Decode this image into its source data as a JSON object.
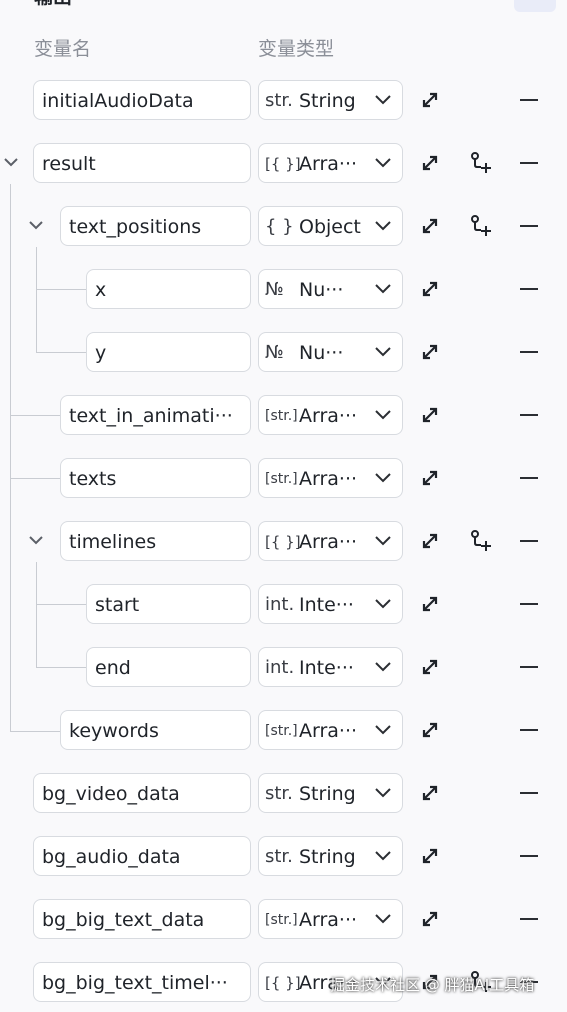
{
  "section": {
    "title": "输出"
  },
  "header": {
    "name_col": "变量名",
    "type_col": "变量类型"
  },
  "rows": [
    {
      "name": "initialAudioData",
      "type_icon": "str.",
      "type_label": "String"
    },
    {
      "name": "result",
      "type_icon": "[{ }]",
      "type_label": "Arra···"
    },
    {
      "name": "text_positions",
      "type_icon": "{ }",
      "type_label": "Object"
    },
    {
      "name": "x",
      "type_icon": "№",
      "type_label": "Nu···"
    },
    {
      "name": "y",
      "type_icon": "№",
      "type_label": "Nu···"
    },
    {
      "name": "text_in_animati···",
      "type_icon": "[str.]",
      "type_label": "Arra···"
    },
    {
      "name": "texts",
      "type_icon": "[str.]",
      "type_label": "Arra···"
    },
    {
      "name": "timelines",
      "type_icon": "[{ }]",
      "type_label": "Arra···"
    },
    {
      "name": "start",
      "type_icon": "int.",
      "type_label": "Inte···"
    },
    {
      "name": "end",
      "type_icon": "int.",
      "type_label": "Inte···"
    },
    {
      "name": "keywords",
      "type_icon": "[str.]",
      "type_label": "Arra···"
    },
    {
      "name": "bg_video_data",
      "type_icon": "str.",
      "type_label": "String"
    },
    {
      "name": "bg_audio_data",
      "type_icon": "str.",
      "type_label": "String"
    },
    {
      "name": "bg_big_text_data",
      "type_icon": "[str.]",
      "type_label": "Arra···"
    },
    {
      "name": "bg_big_text_timel···",
      "type_icon": "[{ }]",
      "type_label": "Arra···"
    }
  ],
  "watermark": "掘金技术社区 @ 胖猫AI工具箱",
  "colors": {
    "border": "#d8dbe0",
    "background": "#f9f9fb",
    "accent": "#e9ecf8"
  }
}
